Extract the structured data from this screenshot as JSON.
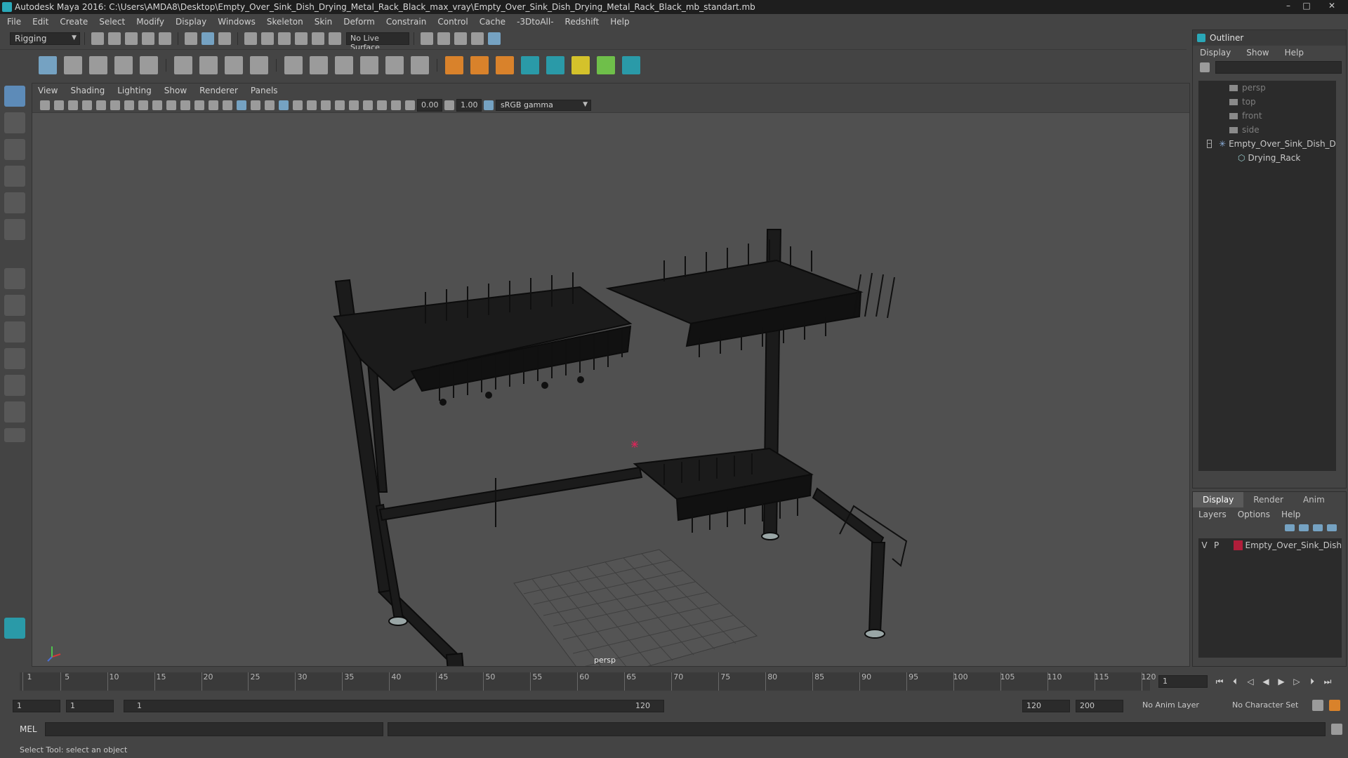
{
  "title": "Autodesk Maya 2016: C:\\Users\\AMDA8\\Desktop\\Empty_Over_Sink_Dish_Drying_Metal_Rack_Black_max_vray\\Empty_Over_Sink_Dish_Drying_Metal_Rack_Black_mb_standart.mb",
  "window_controls": {
    "minimize": "–",
    "maximize": "□",
    "close": "✕"
  },
  "menubar": [
    "File",
    "Edit",
    "Create",
    "Select",
    "Modify",
    "Display",
    "Windows",
    "Skeleton",
    "Skin",
    "Deform",
    "Constrain",
    "Control",
    "Cache",
    "-3DtoAll-",
    "Redshift",
    "Help"
  ],
  "statusline": {
    "menuset": "Rigging",
    "live_surface": "No Live Surface"
  },
  "panel": {
    "menus": [
      "View",
      "Shading",
      "Lighting",
      "Show",
      "Renderer",
      "Panels"
    ],
    "exposure": "0.00",
    "gamma": "1.00",
    "colorspace": "sRGB gamma",
    "camera": "persp"
  },
  "outliner": {
    "title": "Outliner",
    "menus": [
      "Display",
      "Show",
      "Help"
    ],
    "items": [
      {
        "label": "persp",
        "kind": "camera"
      },
      {
        "label": "top",
        "kind": "camera"
      },
      {
        "label": "front",
        "kind": "camera"
      },
      {
        "label": "side",
        "kind": "camera"
      },
      {
        "label": "Empty_Over_Sink_Dish_Di",
        "kind": "group"
      },
      {
        "label": "Drying_Rack",
        "kind": "mesh"
      }
    ]
  },
  "layers": {
    "tabs": [
      "Display",
      "Render",
      "Anim"
    ],
    "active_tab": "Display",
    "menus": [
      "Layers",
      "Options",
      "Help"
    ],
    "rows": [
      {
        "v": "V",
        "p": "P",
        "name": "Empty_Over_Sink_Dish",
        "color": "#b01e3a"
      }
    ]
  },
  "timeline": {
    "ticks": [
      1,
      5,
      10,
      15,
      20,
      25,
      30,
      35,
      40,
      45,
      50,
      55,
      60,
      65,
      70,
      75,
      80,
      85,
      90,
      95,
      100,
      105,
      110,
      115,
      120
    ],
    "current_frame": "1"
  },
  "range": {
    "start": "1",
    "anim_start": "1",
    "slider_start": "1",
    "slider_end": "120",
    "end": "120",
    "anim_end": "200",
    "anim_layer": "No Anim Layer",
    "char_set": "No Character Set"
  },
  "command": {
    "label": "MEL"
  },
  "help_line": "Select Tool: select an object"
}
